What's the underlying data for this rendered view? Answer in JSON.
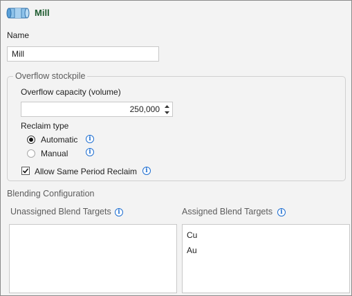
{
  "header": {
    "title": "Mill",
    "icon": "mill-icon"
  },
  "name_field": {
    "label": "Name",
    "value": "Mill"
  },
  "overflow": {
    "legend": "Overflow stockpile",
    "capacity_label": "Overflow capacity (volume)",
    "capacity_value": "250,000",
    "reclaim_type_label": "Reclaim type",
    "reclaim_options": [
      {
        "label": "Automatic",
        "selected": true
      },
      {
        "label": "Manual",
        "selected": false
      }
    ],
    "allow_same_period_label": "Allow Same Period Reclaim",
    "allow_same_period_checked": true
  },
  "blending": {
    "heading": "Blending Configuration",
    "unassigned_label": "Unassigned Blend Targets",
    "assigned_label": "Assigned Blend Targets",
    "unassigned_items": [],
    "assigned_items": [
      "Cu",
      "Au"
    ]
  },
  "colors": {
    "title": "#1d5a2e",
    "info": "#1f6fd1",
    "panel": "#f3f3f3"
  }
}
